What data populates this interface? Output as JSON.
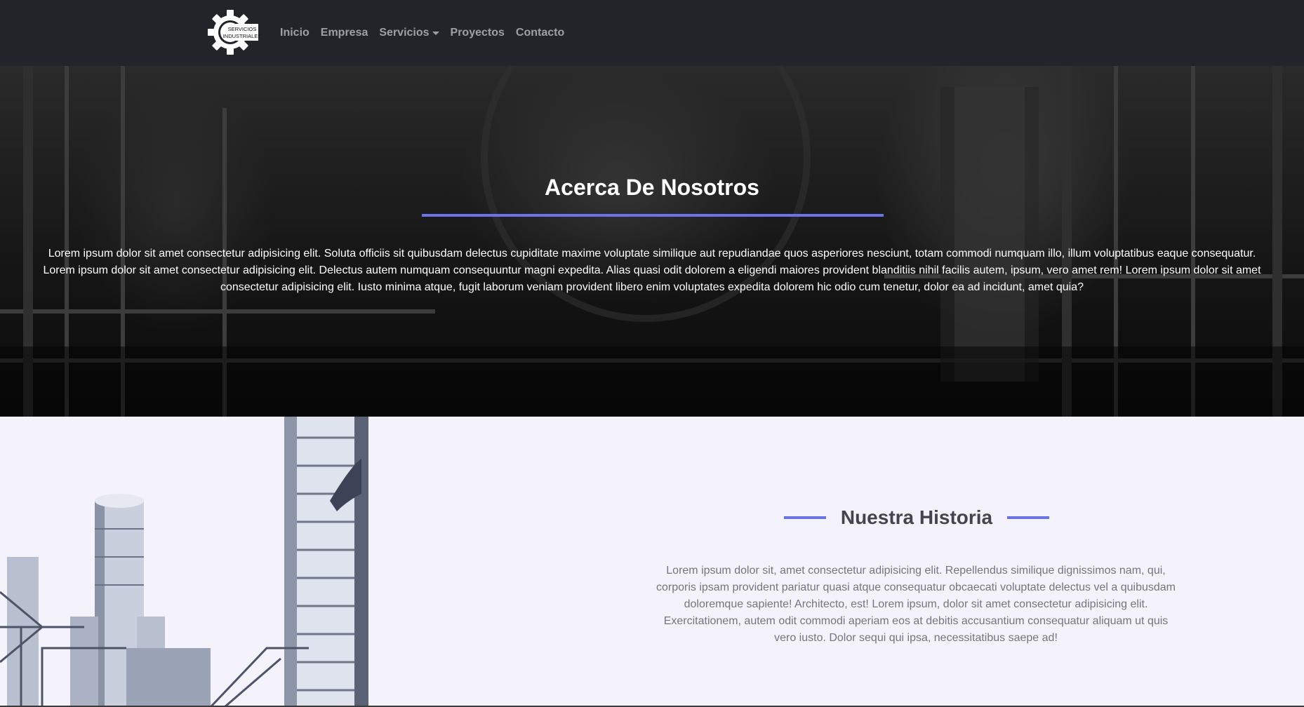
{
  "brand": {
    "logo_text_line1": "SERVICIOS",
    "logo_text_line2": "INDUSTRIALES"
  },
  "nav": {
    "items": [
      {
        "label": "Inicio"
      },
      {
        "label": "Empresa"
      },
      {
        "label": "Servicios",
        "dropdown": true
      },
      {
        "label": "Proyectos"
      },
      {
        "label": "Contacto"
      }
    ]
  },
  "hero": {
    "title": "Acerca De Nosotros",
    "text": "Lorem ipsum dolor sit amet consectetur adipisicing elit. Soluta officiis sit quibusdam delectus cupiditate maxime voluptate similique aut repudiandae quos asperiores nesciunt, totam commodi numquam illo, illum voluptatibus eaque consequatur. Lorem ipsum dolor sit amet consectetur adipisicing elit. Delectus autem numquam consequuntur magni expedita. Alias quasi odit dolorem a eligendi maiores provident blanditiis nihil facilis autem, ipsum, vero amet rem! Lorem ipsum dolor sit amet consectetur adipisicing elit. Iusto minima atque, fugit laborum veniam provident libero enim voluptates expedita dolorem hic odio cum tenetur, dolor ea ad incidunt, amet quia?"
  },
  "historia": {
    "title": "Nuestra Historia",
    "text": "Lorem ipsum dolor sit, amet consectetur adipisicing elit. Repellendus similique dignissimos nam, qui, corporis ipsam provident pariatur quasi atque consequatur obcaecati voluptate delectus vel a quibusdam doloremque sapiente! Architecto, est! Lorem ipsum, dolor sit amet consectetur adipisicing elit. Exercitationem, autem odit commodi aperiam eos at debitis accusantium consequatur aliquam ut quis vero iusto. Dolor sequi qui ipsa, necessitatibus saepe ad!"
  },
  "colors": {
    "navbar_bg": "#212429",
    "nav_link": "#9da1a7",
    "accent": "#6a74e8",
    "section_bg": "#f4f3fc",
    "heading_dark": "#44444c",
    "body_gray": "#75757d"
  },
  "icons": {
    "logo": "gear-icon",
    "dropdown": "caret-down-icon"
  }
}
